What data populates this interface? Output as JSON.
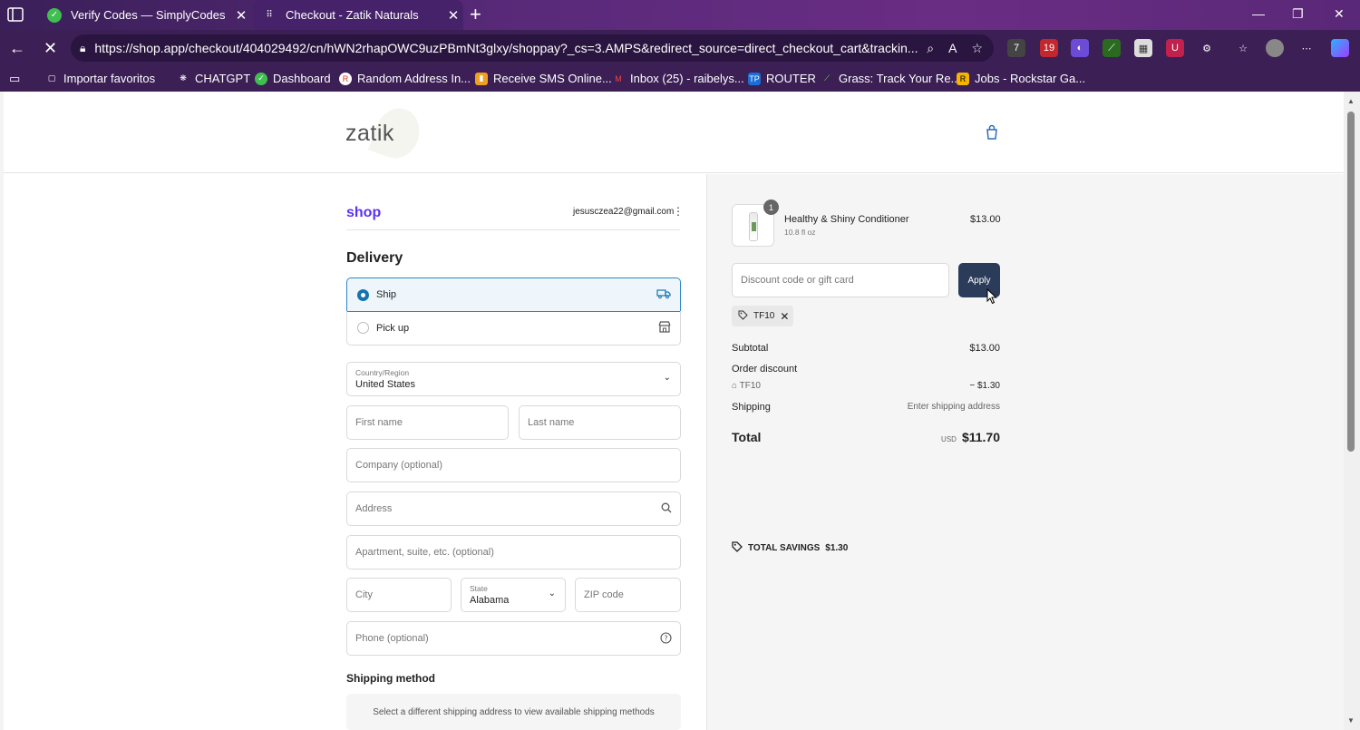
{
  "browser": {
    "tabs": [
      {
        "title": "Verify Codes — SimplyCodes",
        "active": false
      },
      {
        "title": "Checkout - Zatik Naturals",
        "active": true
      }
    ],
    "url": "https://shop.app/checkout/404029492/cn/hWN2rhapOWC9uzPBmNt3glxy/shoppay?_cs=3.AMPS&redirect_source=direct_checkout_cart&trackin...",
    "extension_badges": {
      "ext1": "7",
      "ext2": "19"
    },
    "bookmarks": [
      {
        "label": "Importar favoritos",
        "icon": "folder-icon"
      },
      {
        "label": "CHATGPT",
        "icon": "openai-icon"
      },
      {
        "label": "Dashboard",
        "icon": "dashboard-icon"
      },
      {
        "label": "Random Address In...",
        "icon": "address-icon"
      },
      {
        "label": "Receive SMS Online...",
        "icon": "sms-icon"
      },
      {
        "label": "Inbox (25) - raibelys...",
        "icon": "gmail-icon"
      },
      {
        "label": "ROUTER",
        "icon": "router-icon"
      },
      {
        "label": "Grass: Track Your Re...",
        "icon": "grass-icon"
      },
      {
        "label": "Jobs - Rockstar Ga...",
        "icon": "rockstar-icon"
      }
    ]
  },
  "header": {
    "brand": "zatik"
  },
  "checkout": {
    "shop_logo": "shop",
    "email": "jesusczea22@gmail.com",
    "delivery_title": "Delivery",
    "options": {
      "ship": "Ship",
      "pickup": "Pick up"
    },
    "fields": {
      "country_label": "Country/Region",
      "country_value": "United States",
      "first_name": "First name",
      "last_name": "Last name",
      "company": "Company (optional)",
      "address": "Address",
      "apartment": "Apartment, suite, etc. (optional)",
      "city": "City",
      "state_label": "State",
      "state_value": "Alabama",
      "zip": "ZIP code",
      "phone": "Phone (optional)"
    },
    "shipping_method_title": "Shipping method",
    "shipping_method_note": "Select a different shipping address to view available shipping methods"
  },
  "summary": {
    "product": {
      "name": "Healthy & Shiny Conditioner",
      "variant": "10.8 fl oz",
      "price": "$13.00",
      "qty": "1"
    },
    "discount_placeholder": "Discount code or gift card",
    "apply_label": "Apply",
    "applied_code": "TF10",
    "subtotal_label": "Subtotal",
    "subtotal": "$13.00",
    "order_discount_label": "Order discount",
    "discount_code": "TF10",
    "discount_amount": "− $1.30",
    "shipping_label": "Shipping",
    "shipping_value": "Enter shipping address",
    "total_label": "Total",
    "currency": "USD",
    "total": "$11.70",
    "savings_label": "TOTAL SAVINGS",
    "savings_amount": "$1.30"
  }
}
